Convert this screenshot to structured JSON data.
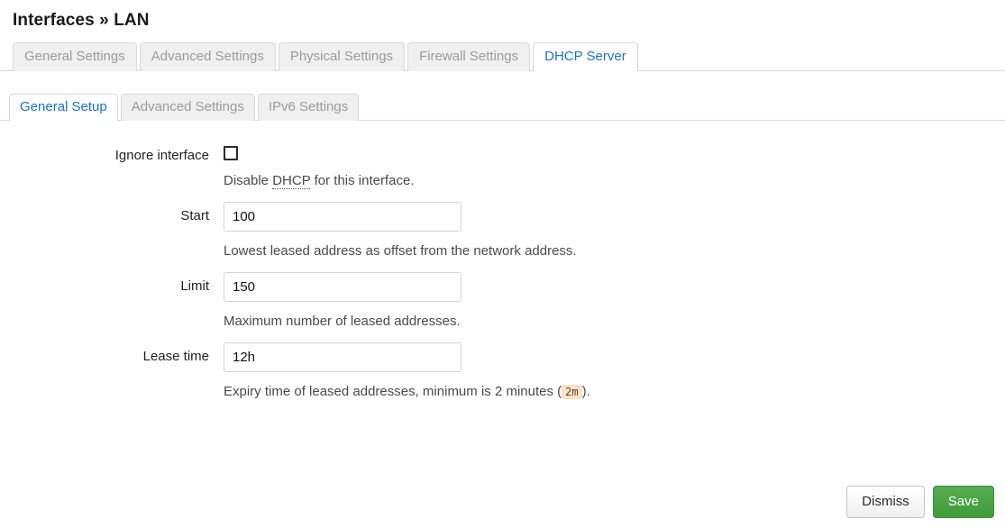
{
  "page": {
    "title": "Interfaces » LAN"
  },
  "primary_tabs": [
    {
      "label": "General Settings",
      "active": false
    },
    {
      "label": "Advanced Settings",
      "active": false
    },
    {
      "label": "Physical Settings",
      "active": false
    },
    {
      "label": "Firewall Settings",
      "active": false
    },
    {
      "label": "DHCP Server",
      "active": true
    }
  ],
  "secondary_tabs": [
    {
      "label": "General Setup",
      "active": true
    },
    {
      "label": "Advanced Settings",
      "active": false
    },
    {
      "label": "IPv6 Settings",
      "active": false
    }
  ],
  "form": {
    "ignore_interface": {
      "label": "Ignore interface",
      "checked": false,
      "hint_before": "Disable ",
      "hint_abbr": "DHCP",
      "hint_after": " for this interface."
    },
    "start": {
      "label": "Start",
      "value": "100",
      "hint": "Lowest leased address as offset from the network address."
    },
    "limit": {
      "label": "Limit",
      "value": "150",
      "hint": "Maximum number of leased addresses."
    },
    "lease_time": {
      "label": "Lease time",
      "value": "12h",
      "hint_before": "Expiry time of leased addresses, minimum is 2 minutes (",
      "hint_code": "2m",
      "hint_after": ")."
    }
  },
  "footer": {
    "dismiss_label": "Dismiss",
    "save_label": "Save"
  },
  "colors": {
    "accent_blue": "#1873cc",
    "save_green": "#3f9c3a",
    "badge_bg": "#fbe3c7",
    "border_gray": "#d9d9d9"
  }
}
